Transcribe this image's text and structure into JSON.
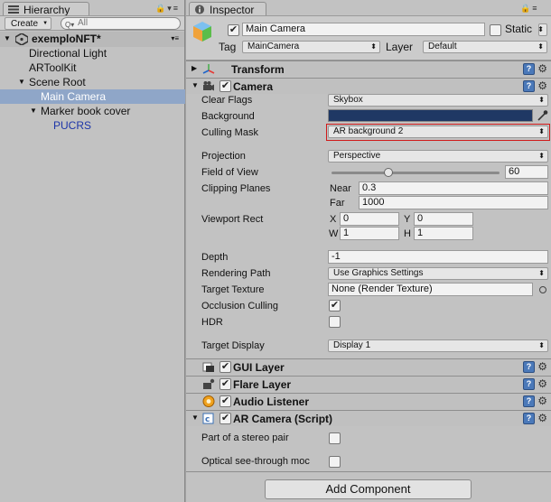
{
  "hierarchy": {
    "tab_label": "Hierarchy",
    "create_label": "Create",
    "search_placeholder": "All",
    "scene_name": "exemploNFT*",
    "items": [
      {
        "label": "Directional Light"
      },
      {
        "label": "ARToolKit"
      },
      {
        "label": "Scene Root"
      },
      {
        "label": "Main Camera"
      },
      {
        "label": "Marker book cover"
      },
      {
        "label": "PUCRS"
      }
    ]
  },
  "inspector": {
    "tab_label": "Inspector",
    "object_name": "Main Camera",
    "static_label": "Static",
    "tag_label": "Tag",
    "tag_value": "MainCamera",
    "layer_label": "Layer",
    "layer_value": "Default",
    "components": {
      "transform": "Transform",
      "camera": "Camera",
      "gui_layer": "GUI Layer",
      "flare_layer": "Flare Layer",
      "audio_listener": "Audio Listener",
      "ar_camera": "AR Camera (Script)"
    },
    "camera": {
      "clear_flags_label": "Clear Flags",
      "clear_flags_value": "Skybox",
      "background_label": "Background",
      "background_color": "#1f3864",
      "culling_mask_label": "Culling Mask",
      "culling_mask_value": "AR background 2",
      "projection_label": "Projection",
      "projection_value": "Perspective",
      "fov_label": "Field of View",
      "fov_value": "60",
      "fov_fraction": 0.33,
      "clipping_label": "Clipping Planes",
      "near_label": "Near",
      "near_value": "0.3",
      "far_label": "Far",
      "far_value": "1000",
      "viewport_label": "Viewport Rect",
      "x_label": "X",
      "x_value": "0",
      "y_label": "Y",
      "y_value": "0",
      "w_label": "W",
      "w_value": "1",
      "h_label": "H",
      "h_value": "1",
      "depth_label": "Depth",
      "depth_value": "-1",
      "rendering_path_label": "Rendering Path",
      "rendering_path_value": "Use Graphics Settings",
      "target_texture_label": "Target Texture",
      "target_texture_value": "None (Render Texture)",
      "occlusion_label": "Occlusion Culling",
      "hdr_label": "HDR",
      "target_display_label": "Target Display",
      "target_display_value": "Display 1"
    },
    "ar_camera": {
      "stereo_label": "Part of a stereo pair",
      "optical_label": "Optical see-through moc"
    },
    "add_component_label": "Add Component"
  }
}
